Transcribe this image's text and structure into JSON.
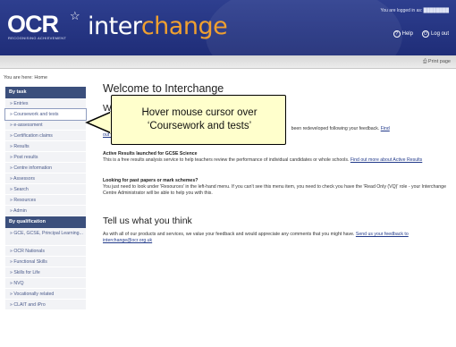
{
  "header": {
    "logo": "OCR",
    "tagline": "RECOGNISING ACHIEVEMENT",
    "brand_part1": "inter",
    "brand_part2": "change",
    "logged_in": "You are logged in as: ████████",
    "help": "Help",
    "logout": "Log out",
    "colors": {
      "header_bg": "#2e3f8f",
      "accent": "#f0a030"
    }
  },
  "toolbar": {
    "print": "Print page"
  },
  "breadcrumb": "You are here: Home",
  "sidebar": {
    "by_task_heading": "By task",
    "task_items": [
      "Entries",
      "Coursework and tests",
      "e-assessment",
      "Certification claims",
      "Results",
      "Post results",
      "Centre information",
      "Assessors",
      "Search",
      "Resources",
      "Admin"
    ],
    "by_qualification_heading": "By qualification",
    "qual_items": [
      "GCE, GCSE, Principal Learning...",
      "OCR Nationals",
      "Functional Skills",
      "Skills for Life",
      "NVQ",
      "Vocationally related",
      "CLAIT and iPro"
    ]
  },
  "main": {
    "title": "Welcome to Interchange",
    "subtitle_cut": "Wh",
    "p1_start": "We",
    "p1_tail": "been redeveloped following your feedback.",
    "p1_link": "Find",
    "p1_tail2": "out m",
    "sec2_title": "Active Results launched for GCSE Science",
    "sec2_text": "This is a free results analysis service to help teachers review the performance of individual candidates or whole schools.",
    "sec2_link": "Find out more about Active Results",
    "sec3_title": "Looking for past papers or mark schemes?",
    "sec3_text": "You just need to look under 'Resources' in the left-hand menu. If you can't see this menu item, you need to check you have the 'Read Only (VQ)' role - your Interchange Centre Administrator will be able to help you with this.",
    "tell_title": "Tell us what you think",
    "tell_text": "As with all of our products and services, we value your feedback and would appreciate any comments that you might have.",
    "tell_link": "Send us your feedback to interchange@ocr.org.uk"
  },
  "callout": {
    "line1": "Hover mouse cursor over",
    "line2": "‘Coursework and tests’"
  }
}
